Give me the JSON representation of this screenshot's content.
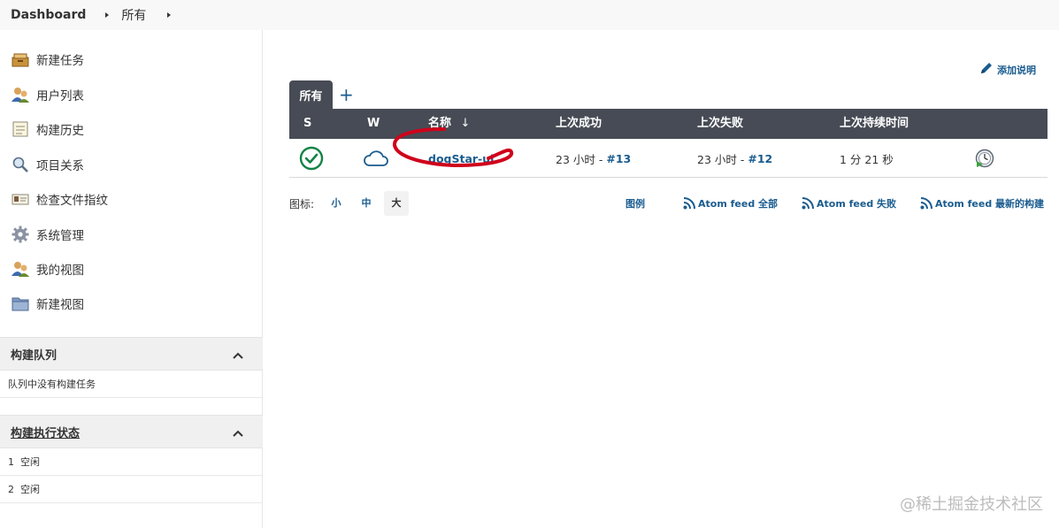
{
  "breadcrumb": {
    "root": "Dashboard",
    "current": "所有"
  },
  "sidebar": {
    "tasks": [
      {
        "label": "新建任务",
        "icon": "new-task-icon"
      },
      {
        "label": "用户列表",
        "icon": "users-icon"
      },
      {
        "label": "构建历史",
        "icon": "build-history-icon"
      },
      {
        "label": "项目关系",
        "icon": "magnifier-icon"
      },
      {
        "label": "检查文件指纹",
        "icon": "fingerprint-icon"
      },
      {
        "label": "系统管理",
        "icon": "gear-icon"
      },
      {
        "label": "我的视图",
        "icon": "users-icon"
      },
      {
        "label": "新建视图",
        "icon": "folder-icon"
      }
    ],
    "build_queue": {
      "title": "构建队列",
      "empty_text": "队列中没有构建任务"
    },
    "executors": {
      "title": "构建执行状态",
      "rows": [
        {
          "num": "1",
          "status": "空闲"
        },
        {
          "num": "2",
          "status": "空闲"
        }
      ]
    }
  },
  "main": {
    "add_description": "添加说明",
    "tabs": [
      {
        "label": "所有"
      }
    ],
    "add_tab": "+",
    "table": {
      "headers": {
        "s": "S",
        "w": "W",
        "name": "名称",
        "sort": "↓",
        "last_success": "上次成功",
        "last_failure": "上次失败",
        "last_duration": "上次持续时间"
      },
      "rows": [
        {
          "name": "dogStar-ui",
          "success_time": "23 小时 - ",
          "success_build": "#13",
          "failure_time": "23 小时 - ",
          "failure_build": "#12",
          "duration": "1 分 21 秒"
        }
      ]
    },
    "icon_legend": {
      "label": "图标:",
      "sizes": [
        "小",
        "中",
        "大"
      ],
      "selected": "大"
    },
    "links": {
      "legend": "图例",
      "feed_all": "Atom feed 全部",
      "feed_failed": "Atom feed 失败",
      "feed_latest": "Atom feed 最新的构建"
    }
  },
  "watermark": "@稀土掘金技术社区",
  "colors": {
    "header": "#474b55",
    "link": "#1a5c8f",
    "success": "#138347",
    "annotation": "#d0021b"
  }
}
